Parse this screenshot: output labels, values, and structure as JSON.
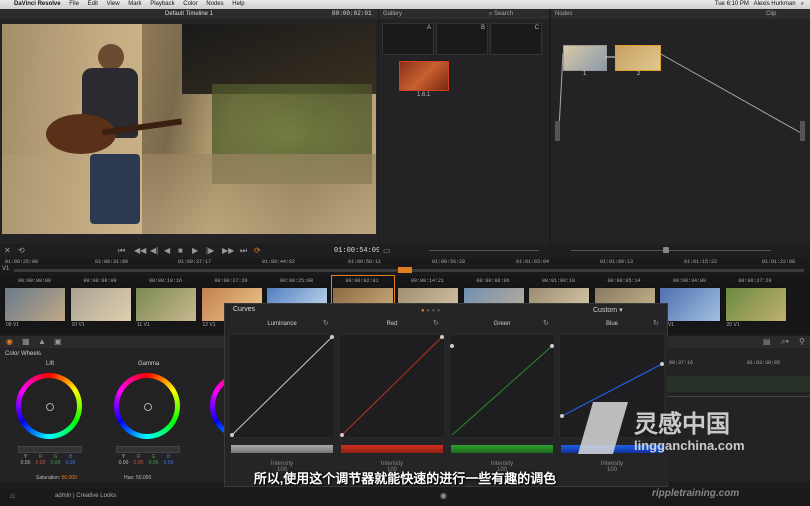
{
  "menubar": {
    "app": "DaVinci Resolve",
    "items": [
      "File",
      "Edit",
      "View",
      "Mark",
      "Playback",
      "Color",
      "Nodes",
      "Help"
    ],
    "clock": "Tue 6:10 PM",
    "user": "Alexis Hurkman"
  },
  "viewer": {
    "timeline_name": "Default Timeline 1",
    "timecode": "00:00:02:01",
    "transport_timecode": "01:00:54:09"
  },
  "gallery": {
    "title": "Gallery",
    "search": "Search",
    "slots": [
      "A",
      "B",
      "C"
    ],
    "still_label": "1.6.1"
  },
  "nodes": {
    "title": "Nodes",
    "clip": "Clip",
    "node_labels": [
      "1",
      "2"
    ]
  },
  "timeline": {
    "track": "V1",
    "ruler": [
      "01:00:25:00",
      "01:00:31:09",
      "01:00:37:17",
      "01:00:44:02",
      "01:00:50:11",
      "01:00:56:20",
      "01:01:03:04",
      "01:01:09:13",
      "01:01:15:22",
      "01:01:22:08"
    ]
  },
  "clips": [
    {
      "tc": "00:00:00:00",
      "label": "09 V1"
    },
    {
      "tc": "00:00:08:00",
      "label": "10 V1"
    },
    {
      "tc": "00:00:10:16",
      "label": "11 V1"
    },
    {
      "tc": "00:00:27:20",
      "label": "12 V1"
    },
    {
      "tc": "00:08:25:08",
      "label": "13 V1"
    },
    {
      "tc": "00:00:02:01",
      "label": "14 V1"
    },
    {
      "tc": "00:00:14:21",
      "label": "15 V1"
    },
    {
      "tc": "00:00:06:06",
      "label": "16 V1"
    },
    {
      "tc": "00:01:09:18",
      "label": "17 V1"
    },
    {
      "tc": "00:00:05:14",
      "label": "18 V1"
    },
    {
      "tc": "00:00:34:00",
      "label": "19 V1"
    },
    {
      "tc": "00:00:27:20",
      "label": "20 V1"
    }
  ],
  "colorwheels": {
    "title": "Color Wheels",
    "lift": "Lift",
    "gamma": "Gamma",
    "labels": [
      "Y",
      "R",
      "G",
      "B"
    ],
    "lift_values": [
      "0.00",
      "0.00",
      "0.00",
      "0.00"
    ],
    "gamma_values": [
      "0.00",
      "0.00",
      "0.00",
      "0.00"
    ],
    "saturation_label": "Saturation:",
    "saturation_value": "50.000",
    "hue_label": "Hue:",
    "hue_value": "50.000"
  },
  "curves": {
    "title": "Curves",
    "mode": "Custom",
    "channels": [
      "Luminance",
      "Red",
      "Green",
      "Blue"
    ],
    "intensity_label": "Intensity",
    "intensity_values": [
      "100",
      "100",
      "100",
      "100"
    ],
    "colors": {
      "luma": "#dddddd",
      "red": "#d03020",
      "green": "#30a030",
      "blue": "#2060e0"
    }
  },
  "right_panel": {
    "times": [
      "00:37:16",
      "01:03:39:05"
    ]
  },
  "footer": {
    "project": "admin | Creative Looks"
  },
  "subtitle": "所以,使用这个调节器就能快速的进行一些有趣的调色",
  "watermark": {
    "cn": "灵感中国",
    "url": "lingganchina.com",
    "brand": "rippletraining.com"
  }
}
